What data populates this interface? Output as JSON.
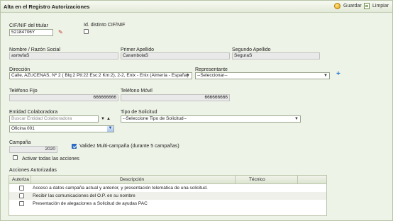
{
  "header": {
    "title": "Alta en el Registro Autorizaciones",
    "save_label": "Guardar",
    "clear_label": "Limpiar"
  },
  "titular": {
    "cif_label": "CIF/NIF del titular",
    "cif_value": "52184706Y",
    "id_distinto_label": "Id. distinto CIF/NIF"
  },
  "nombre": {
    "label": "Nombre / Razón Social",
    "value": "asrtwfaS"
  },
  "apellido1": {
    "label": "Primer Apellido",
    "value": "CarambolaS"
  },
  "apellido2": {
    "label": "Segundo Apellido",
    "value": "SeguraS"
  },
  "direccion": {
    "label": "Dirección",
    "value": "Calle, AZUCENAS, Nº 2 ( Blq:2 Ptl:22 Esc:2 Km:2), 2-2, Enix - Enix (Almería - España)"
  },
  "representante": {
    "label": "Representante",
    "selected": "--Seleccionar--"
  },
  "telefono_fijo": {
    "label": "Teléfono Fijo",
    "value": "666666666"
  },
  "telefono_movil": {
    "label": "Teléfono Móvil",
    "value": "666666666"
  },
  "entidad": {
    "label": "Entidad Colaboradora",
    "placeholder": "Buscar Entidad Colaboradora",
    "oficina_selected": "Oficina 001",
    "sort_up": "▼",
    "sort_down": "▲"
  },
  "tipo_solicitud": {
    "label": "Tipo de Solicitud",
    "selected": "--Seleccione Tipo de Solicitud--"
  },
  "campania": {
    "label": "Campaña",
    "value": "2020",
    "multi_label": "Validez Multi-campaña (durante 5 campañas)",
    "multi_checked": true
  },
  "activar_todas": {
    "label": "Activar todas las acciones"
  },
  "acciones": {
    "section_label": "Acciones Autorizadas",
    "columns": {
      "autoriza": "Autoriza",
      "descripcion": "Descripción",
      "tecnico": "Técnico"
    },
    "rows": [
      {
        "descripcion": "Acceso a datos campaña actual y anterior, y presentación telemática de una solicitud."
      },
      {
        "descripcion": "Recibir las comunicaciones del O.P. en su nombre"
      },
      {
        "descripcion": "Presentación de alegaciones a Solicitud de ayudas PAC"
      }
    ]
  },
  "icons": {
    "save": "save-icon",
    "clear": "clear-icon",
    "search_person": "wand-icon",
    "add": "plus-icon"
  }
}
